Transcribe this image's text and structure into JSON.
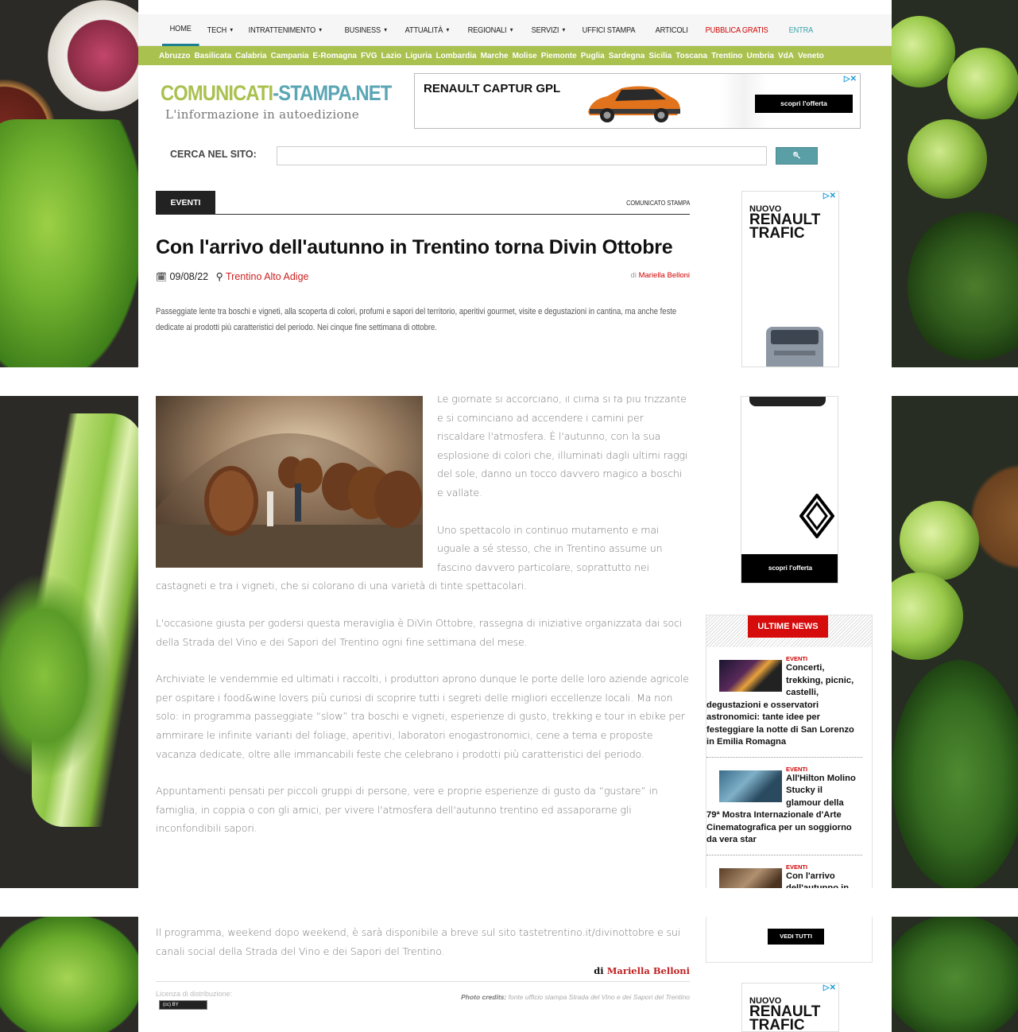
{
  "nav": {
    "items": [
      {
        "label": "HOME",
        "caret": false
      },
      {
        "label": "TECH",
        "caret": true
      },
      {
        "label": "INTRATTENIMENTO",
        "caret": true
      },
      {
        "label": "BUSINESS",
        "caret": true
      },
      {
        "label": "ATTUALITÀ",
        "caret": true
      },
      {
        "label": "REGIONALI",
        "caret": true
      },
      {
        "label": "SERVIZI",
        "caret": true
      },
      {
        "label": "UFFICI STAMPA",
        "caret": false
      },
      {
        "label": "ARTICOLI",
        "caret": false
      },
      {
        "label": "PUBBLICA GRATIS",
        "caret": false
      },
      {
        "label": "ENTRA",
        "caret": false
      }
    ],
    "caret_icon": "▾"
  },
  "regions": [
    "Abruzzo",
    "Basilicata",
    "Calabria",
    "Campania",
    "E-Romagna",
    "FVG",
    "Lazio",
    "Liguria",
    "Lombardia",
    "Marche",
    "Molise",
    "Piemonte",
    "Puglia",
    "Sardegna",
    "Sicilia",
    "Toscana",
    "Trentino",
    "Umbria",
    "VdA",
    "Veneto"
  ],
  "logo": {
    "part1": "COMUNICATI",
    "dash": "-",
    "part2": "STAMPA.NET",
    "tagline": "L'informazione in autoedizione"
  },
  "ad_top": {
    "title": "RENAULT CAPTUR GPL",
    "cta": "scopri l'offerta",
    "adchoice": "▷✕"
  },
  "search": {
    "label": "CERCA NEL SITO:",
    "button_icon": "🔍",
    "value": ""
  },
  "article": {
    "category": "EVENTI",
    "type": "COMUNICATO STAMPA",
    "title": "Con l'arrivo dell'autunno in Trentino torna Divin Ottobre",
    "date_icon": "🗓",
    "date": "09/08/22",
    "location_icon": "⚲",
    "location": "Trentino Alto Adige",
    "by_prefix": "di",
    "author": "Mariella Belloni",
    "summary": "Passeggiate lente tra boschi e vigneti, alla scoperta di colori, profumi e sapori del territorio, aperitivi gourmet, visite e degustazioni in cantina, ma anche feste dedicate ai prodotti più caratteristici del periodo. Nei cinque fine settimana di ottobre.",
    "paragraphs": [
      "Le giornate si accorciano, il clima si fa più frizzante e si cominciano ad accendere i camini per riscaldare l'atmosfera. È l'autunno, con la sua esplosione di colori che, illuminati dagli ultimi raggi del sole, danno un tocco davvero magico a boschi e vallate.",
      "Uno spettacolo in continuo mutamento e mai uguale a sé stesso, che in Trentino assume un fascino davvero particolare, soprattutto nei castagneti e tra i vigneti, che si colorano di una varietà di tinte spettacolari.",
      "L'occasione giusta per godersi questa meraviglia è DiVin Ottobre, rassegna di iniziative organizzata dai soci della Strada del Vino e dei Sapori del Trentino ogni fine settimana del mese.",
      "Archiviate le vendemmie ed ultimati i raccolti, i produttori aprono dunque le porte delle loro aziende agricole per ospitare i food&wine lovers più curiosi di scoprire tutti i segreti delle migliori eccellenze locali. Ma non solo: in programma passeggiate “slow” tra boschi e vigneti, esperienze di gusto, trekking e tour in ebike per ammirare le infinite varianti del foliage, aperitivi, laboratori enogastronomici, cene a tema e proposte vacanza dedicate, oltre alle immancabili feste che celebrano i prodotti più caratteristici del periodo.",
      "Appuntamenti pensati per piccoli gruppi di persone, vere e proprie esperienze di gusto da “gustare” in famiglia, in coppia o con gli amici, per vivere l'atmosfera dell'autunno trentino ed assaporarne gli inconfondibili sapori.",
      "Il programma, weekend dopo weekend, è sarà disponibile a breve sul sito tastetrentino.it/divinottobre e sui canali social della Strada del Vino e dei Sapori del Trentino."
    ],
    "signature_prefix": "di",
    "signature_name": "Mariella Belloni",
    "license_label": "Licenza di distribuzione:",
    "license_badge": "(cc) BY",
    "credits_label": "Photo credits:",
    "credits_value": "fonte ufficio stampa Strada del Vino e dei Sapori del Trentino"
  },
  "ad_side": {
    "line1": "NUOVO",
    "line2": "RENAULT",
    "line3": "TRAFIC",
    "cta": "scopri l'offerta",
    "adchoice": "▷✕"
  },
  "ultime_news": {
    "label": "ULTIME NEWS",
    "items": [
      {
        "category": "EVENTI",
        "title": "Concerti, trekking, picnic, castelli, degustazioni e osservatori astronomici: tante idee per festeggiare la notte di San Lorenzo in Emilia Romagna"
      },
      {
        "category": "EVENTI",
        "title": "All'Hilton Molino Stucky il glamour della 79ª Mostra Internazionale d'Arte Cinematografica per un soggiorno da vera star"
      },
      {
        "category": "EVENTI",
        "title": "Con l'arrivo dell'autunno in Trentino torna Divin Ottobre"
      }
    ],
    "vedi_tutti": "VEDI TUTTI"
  },
  "colors": {
    "accent_green": "#a9c14f",
    "accent_teal": "#5aa6b4",
    "red": "#d10000"
  }
}
